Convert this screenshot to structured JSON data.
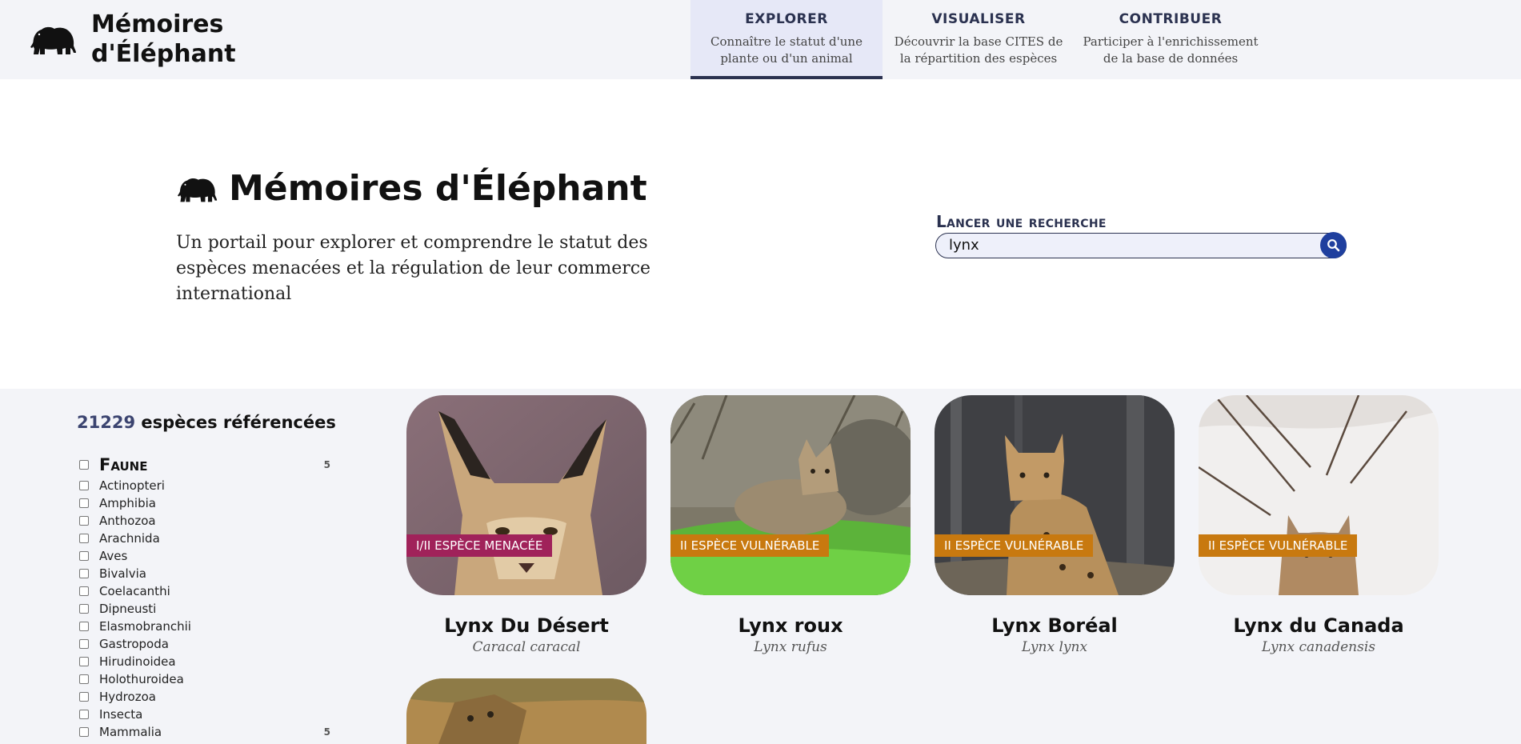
{
  "brand": {
    "name_line1": "Mémoires",
    "name_line2": "d'Éléphant"
  },
  "nav": [
    {
      "title": "EXPLORER",
      "subtitle": "Connaître le statut d'une plante ou d'un animal",
      "active": true
    },
    {
      "title": "VISUALISER",
      "subtitle": "Découvrir la base CITES de la répartition des espèces",
      "active": false
    },
    {
      "title": "CONTRIBUER",
      "subtitle": "Participer à l'enrichissement de la base de données",
      "active": false
    }
  ],
  "hero": {
    "title": "Mémoires d'Éléphant",
    "subtitle": "Un portail pour explorer et comprendre le statut des espèces menacées et la régulation de leur commerce international"
  },
  "search": {
    "label": "Lancer une recherche",
    "value": "lynx"
  },
  "species_count": {
    "number": "21229",
    "label": "espèces référencées"
  },
  "filters": {
    "group": {
      "label": "Faune",
      "count": "5"
    },
    "items": [
      {
        "label": "Actinopteri",
        "count": ""
      },
      {
        "label": "Amphibia",
        "count": ""
      },
      {
        "label": "Anthozoa",
        "count": ""
      },
      {
        "label": "Arachnida",
        "count": ""
      },
      {
        "label": "Aves",
        "count": ""
      },
      {
        "label": "Bivalvia",
        "count": ""
      },
      {
        "label": "Coelacanthi",
        "count": ""
      },
      {
        "label": "Dipneusti",
        "count": ""
      },
      {
        "label": "Elasmobranchii",
        "count": ""
      },
      {
        "label": "Gastropoda",
        "count": ""
      },
      {
        "label": "Hirudinoidea",
        "count": ""
      },
      {
        "label": "Holothuroidea",
        "count": ""
      },
      {
        "label": "Hydrozoa",
        "count": ""
      },
      {
        "label": "Insecta",
        "count": ""
      },
      {
        "label": "Mammalia",
        "count": "5"
      }
    ]
  },
  "results": [
    {
      "name": "Lynx Du Désert",
      "scientific": "Caracal caracal",
      "badge": "I/II ESPÈCE MENACÉE",
      "status": "menacee"
    },
    {
      "name": "Lynx roux",
      "scientific": "Lynx rufus",
      "badge": "II ESPÈCE VULNÉRABLE",
      "status": "vuln"
    },
    {
      "name": "Lynx Boréal",
      "scientific": "Lynx lynx",
      "badge": "II ESPÈCE VULNÉRABLE",
      "status": "vuln"
    },
    {
      "name": "Lynx du Canada",
      "scientific": "Lynx canadensis",
      "badge": "II ESPÈCE VULNÉRABLE",
      "status": "vuln"
    }
  ],
  "colors": {
    "primary": "#2b3250",
    "header_bg": "#f3f4f8",
    "active_tab_bg": "#e6e8f7",
    "search_button": "#1f3f9e",
    "badge_menacee": "#a0225a",
    "badge_vulnerable": "#c8790f"
  },
  "icons": {
    "brand": "elephant-icon",
    "search": "magnifier-icon"
  }
}
